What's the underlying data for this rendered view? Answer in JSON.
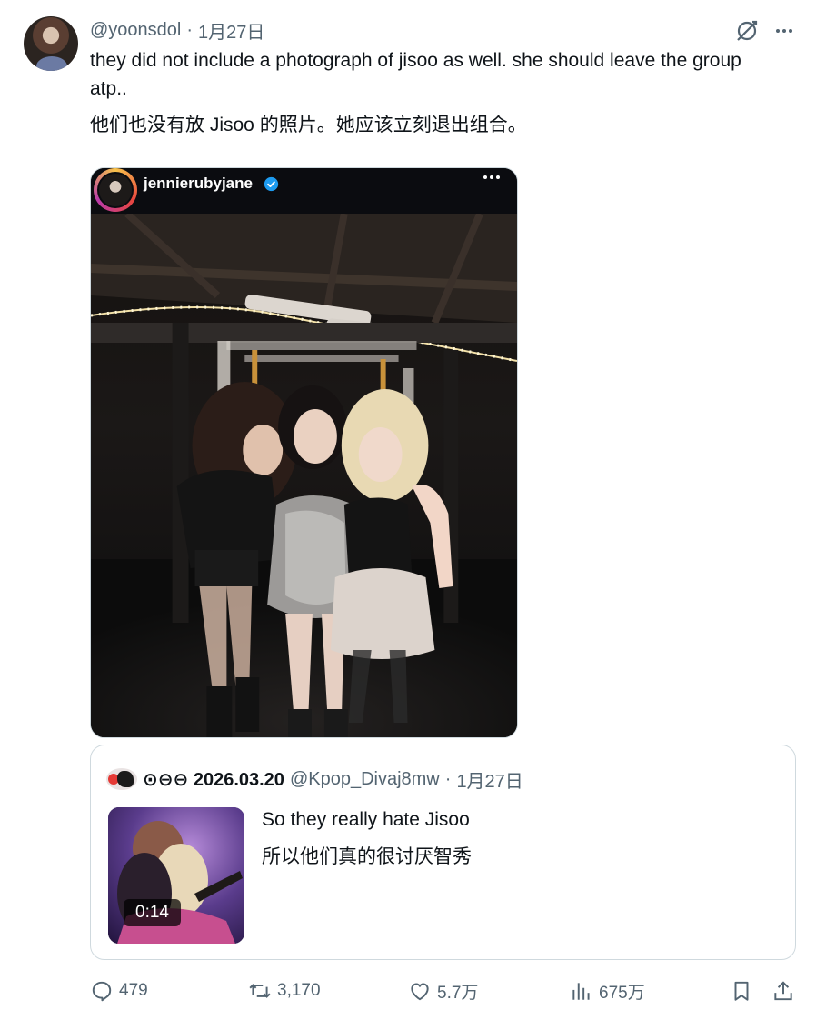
{
  "tweet": {
    "handle": "@yoonsdol",
    "separator": "·",
    "date": "1月27日",
    "text_en": "they did not include a photograph of jisoo as well. she should leave the group atp..",
    "text_zh": "他们也没有放 Jisoo 的照片。她应该立刻退出组合。"
  },
  "media": {
    "ig_username": "jennierubyjane",
    "ig_verified_icon": "verified-badge-icon"
  },
  "quote": {
    "display_name": "⊙⊖⊖ 2026.03.20",
    "handle": "@Kpop_Divaj8mw",
    "separator": "·",
    "date": "1月27日",
    "text_en": "So they really hate Jisoo",
    "text_zh": "所以他们真的很讨厌智秀",
    "video_duration": "0:14"
  },
  "actions": {
    "replies": "479",
    "retweets": "3,170",
    "likes": "5.7万",
    "views": "675万"
  },
  "colors": {
    "text": "#0f1419",
    "secondary": "#536471",
    "border": "#cfd9de",
    "verified": "#1d9bf0"
  }
}
